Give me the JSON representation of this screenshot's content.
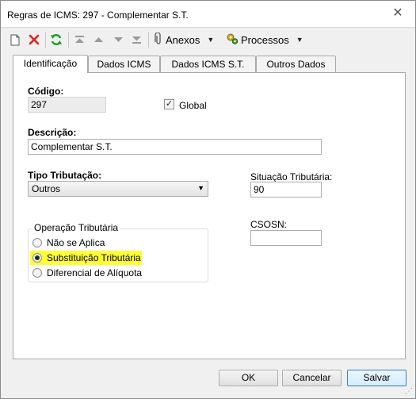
{
  "window": {
    "title": "Regras de ICMS: 297 - Complementar S.T.",
    "close_glyph": "✕"
  },
  "toolbar": {
    "anexos_label": "Anexos",
    "processos_label": "Processos",
    "icons": [
      "new-document-icon",
      "delete-icon",
      "refresh-icon",
      "move-first-icon",
      "move-up-icon",
      "move-down-icon",
      "move-last-icon",
      "paperclip-icon",
      "gears-icon"
    ],
    "colors": {
      "delete": "#e02020",
      "refresh": "#1a9a2a"
    }
  },
  "tabs": [
    {
      "label": "Identificação",
      "active": true
    },
    {
      "label": "Dados ICMS",
      "active": false
    },
    {
      "label": "Dados ICMS S.T.",
      "active": false
    },
    {
      "label": "Outros Dados",
      "active": false
    }
  ],
  "form": {
    "codigo_label": "Código:",
    "codigo_value": "297",
    "global_label": "Global",
    "global_checked": true,
    "descricao_label": "Descrição:",
    "descricao_value": "Complementar S.T.",
    "tipo_tributacao_label": "Tipo Tributação:",
    "tipo_tributacao_value": "Outros",
    "situacao_label": "Situação Tributária:",
    "situacao_value": "90",
    "csosn_label": "CSOSN:",
    "csosn_value": "",
    "operacao_title": "Operação Tributária",
    "operacao_options": [
      {
        "label": "Não se Aplica",
        "checked": false
      },
      {
        "label": "Substituição Tributária",
        "checked": true,
        "highlight": "#ffff33"
      },
      {
        "label": "Diferencial de Alíquota",
        "checked": false
      }
    ]
  },
  "buttons": {
    "ok": "OK",
    "cancel": "Cancelar",
    "save": "Salvar"
  }
}
